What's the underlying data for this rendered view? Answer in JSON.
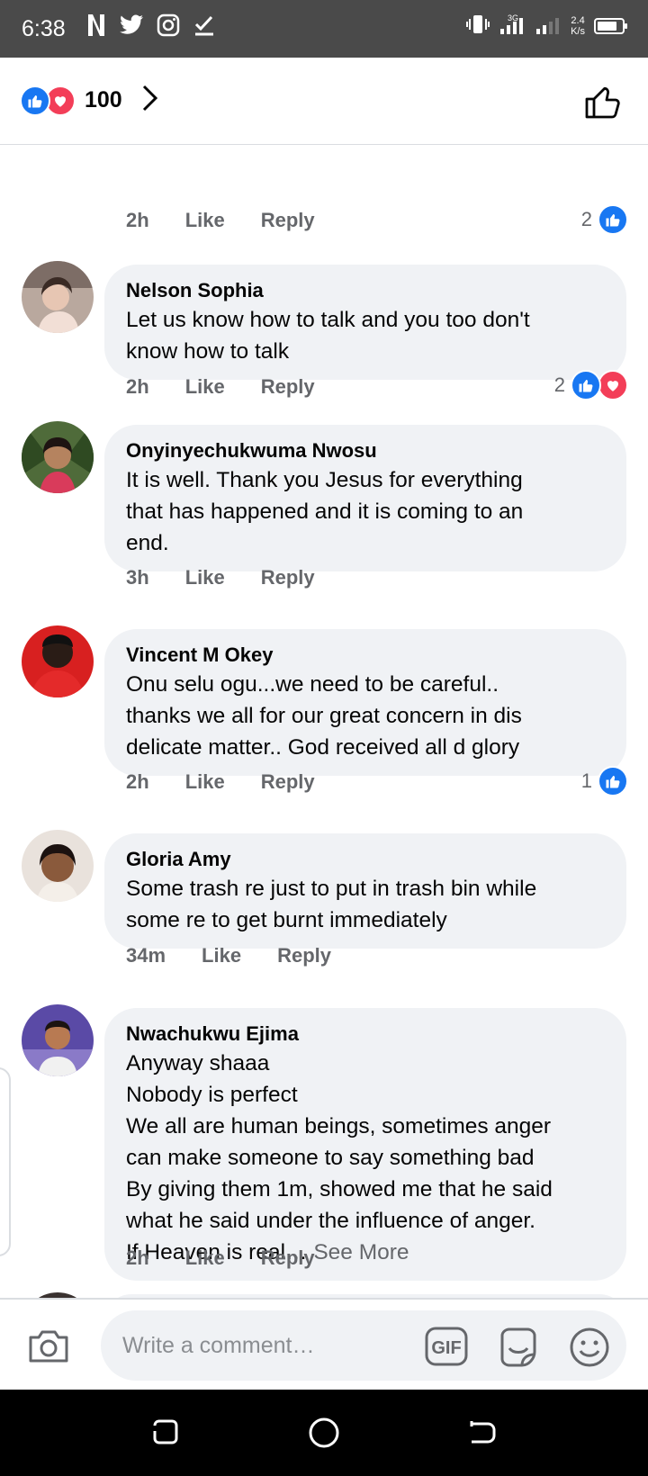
{
  "status_bar": {
    "time": "6:38",
    "net_speed_value": "2.4",
    "net_speed_unit": "K/s",
    "network_type": "3G",
    "battery_level": 0.8
  },
  "header": {
    "reaction_count": "100",
    "reaction_types": [
      "like-icon",
      "love-icon"
    ]
  },
  "comments": [
    {
      "partial": true,
      "time": "2h",
      "like_label": "Like",
      "reply_label": "Reply",
      "reaction_count": "2",
      "reactions": [
        "like"
      ]
    },
    {
      "name": "Nelson Sophia",
      "text": "Let us know how to talk and you too don't\nknow how to talk",
      "time": "2h",
      "like_label": "Like",
      "reply_label": "Reply",
      "reaction_count": "2",
      "reactions": [
        "like",
        "love"
      ]
    },
    {
      "name": "Onyinyechukwuma Nwosu",
      "text": "It is well. Thank you Jesus for everything\nthat has happened and it is coming to an\nend.",
      "time": "3h",
      "like_label": "Like",
      "reply_label": "Reply"
    },
    {
      "name": "Vincent M Okey",
      "text": "Onu selu ogu...we need to be careful..\nthanks we all for our great concern in dis\ndelicate matter.. God received all d glory",
      "time": "2h",
      "like_label": "Like",
      "reply_label": "Reply",
      "reaction_count": "1",
      "reactions": [
        "like"
      ]
    },
    {
      "name": "Gloria Amy",
      "text": "Some trash re just to put in trash bin while\nsome re to get burnt immediately",
      "time": "34m",
      "like_label": "Like",
      "reply_label": "Reply"
    },
    {
      "name": "Nwachukwu Ejima",
      "text": "Anyway shaaa\nNobody is perfect\nWe  all are human beings, sometimes anger\ncan make someone to say something bad\nBy giving them 1m, showed me that he said\nwhat he said under the influence of anger.\nIf Heaven is real…",
      "see_more": " See More",
      "time": "2h",
      "like_label": "Like",
      "reply_label": "Reply"
    }
  ],
  "composer": {
    "placeholder": "Write a comment…",
    "gif_label": "GIF"
  },
  "colors": {
    "accent_blue": "#1877f2",
    "love_red": "#f33e58",
    "bubble_bg": "#f0f2f5",
    "muted_text": "#65676b"
  }
}
